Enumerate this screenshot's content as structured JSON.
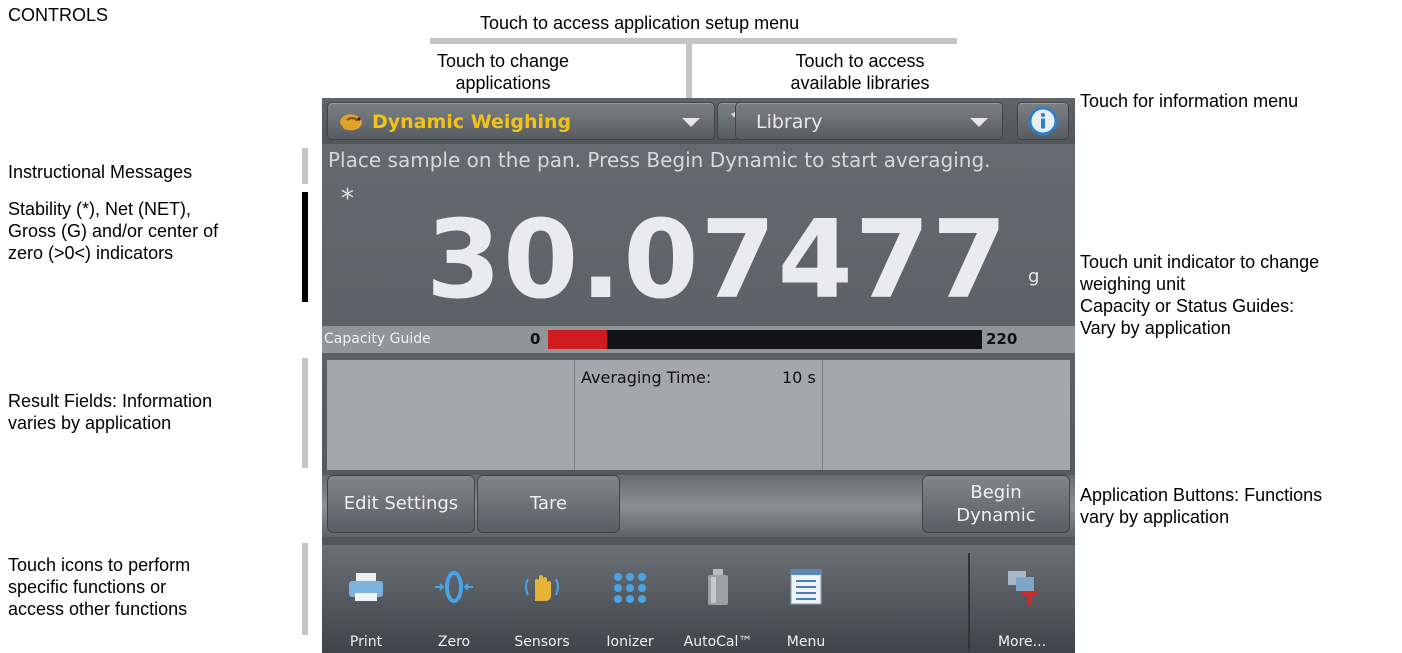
{
  "page": {
    "heading": "CONTROLS"
  },
  "callouts": {
    "setup_menu": "Touch to access application setup menu",
    "change_app_line1": "Touch to change",
    "change_app_line2": "applications",
    "libraries_line1": "Touch to access",
    "libraries_line2": "available libraries",
    "info_menu": "Touch for information menu",
    "instructional": "Instructional Messages",
    "indicators_line1": "Stability (*), Net (NET),",
    "indicators_line2": "Gross (G) and/or center of",
    "indicators_line3": "zero (>0<) indicators",
    "unit_line1": "Touch unit indicator to change",
    "unit_line2": "weighing unit",
    "guides_line1": "Capacity or Status Guides:",
    "guides_line2": "Vary by application",
    "results_line1": "Result Fields: Information",
    "results_line2": "varies by application",
    "appbuttons_line1": "Application Buttons: Functions",
    "appbuttons_line2": "vary by application",
    "icons_line1": "Touch icons to perform",
    "icons_line2": "specific functions or",
    "icons_line3": "access other functions"
  },
  "device": {
    "app_selector": {
      "label": "Dynamic Weighing",
      "icon": "dynamic-weighing-icon"
    },
    "setup_button": {
      "icon": "wrench-icon"
    },
    "library_selector": {
      "label": "Library"
    },
    "info_button": {
      "icon": "info-icon"
    },
    "message": "Place sample on the pan.  Press Begin Dynamic to start averaging.",
    "stability_indicator": "*",
    "weight": "30.07477",
    "unit": "g",
    "capacity_guide": {
      "label": "Capacity Guide",
      "min": "0",
      "max": "220",
      "fill_fraction": 0.135,
      "fill_color": "#d01c1f"
    },
    "results": {
      "averaging_time_label": "Averaging Time:",
      "averaging_time_value": "10 s"
    },
    "app_buttons": {
      "edit_settings": "Edit Settings",
      "tare": "Tare",
      "begin_line1": "Begin",
      "begin_line2": "Dynamic"
    },
    "tray": [
      {
        "label": "Print",
        "icon": "printer-icon"
      },
      {
        "label": "Zero",
        "icon": "zero-icon"
      },
      {
        "label": "Sensors",
        "icon": "hand-sensor-icon"
      },
      {
        "label": "Ionizer",
        "icon": "ionizer-icon"
      },
      {
        "label": "AutoCal™",
        "icon": "calibration-weight-icon"
      },
      {
        "label": "Menu",
        "icon": "menu-list-icon"
      },
      {
        "label": "More...",
        "icon": "more-icon"
      }
    ],
    "accent_color": "#f2c21b"
  }
}
